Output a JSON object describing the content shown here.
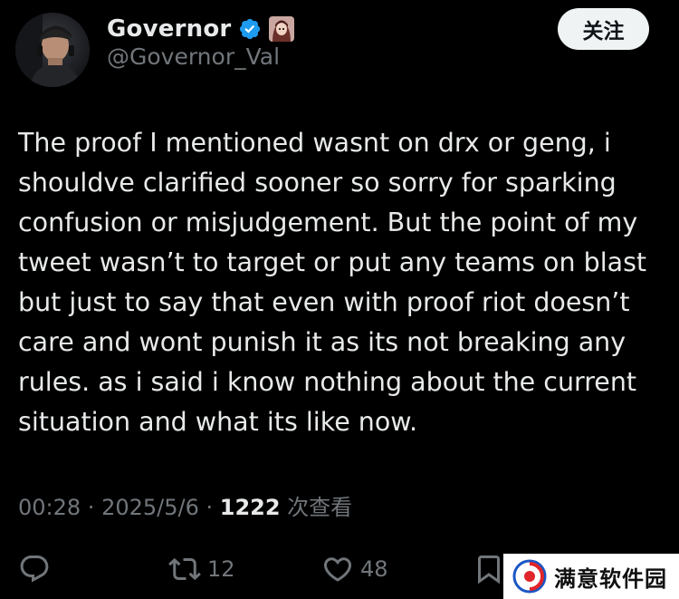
{
  "author": {
    "display_name": "Governor",
    "handle": "@Governor_Val",
    "avatar_icon": "profile-avatar",
    "verified_badge_icon": "verified-badge-icon",
    "emblem_icon": "profile-emblem-icon"
  },
  "header": {
    "follow_label": "关注"
  },
  "tweet": {
    "text": "The proof I mentioned wasnt on drx or geng, i\nshouldve clarified sooner so sorry for sparking\nconfusion or misjudgement. But the point of my\ntweet wasn’t to target or put any teams on blast\nbut just to say that even with proof riot doesn’t\ncare and wont punish it as its not breaking any\nrules. as i said i know nothing about the current\nsituation and what its like now."
  },
  "meta": {
    "time": "00:28",
    "separator": " · ",
    "date": "2025/5/6",
    "views_count": "1222",
    "views_label": " 次查看"
  },
  "actions": {
    "reply_icon": "reply-icon",
    "retweet_icon": "retweet-icon",
    "retweet_count": "12",
    "like_icon": "like-icon",
    "like_count": "48",
    "bookmark_icon": "bookmark-icon"
  },
  "watermark": {
    "text": "满意软件园"
  },
  "colors": {
    "background": "#000000",
    "text_primary": "#e7e9ea",
    "text_secondary": "#71767b",
    "verified_blue": "#1d9bf0",
    "follow_button_bg": "#eff3f4"
  }
}
